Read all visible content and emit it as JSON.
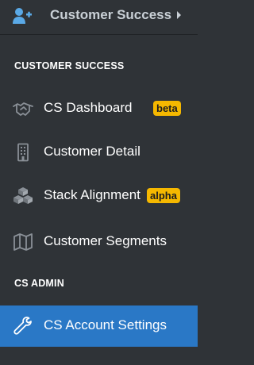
{
  "header": {
    "title": "Customer Success",
    "lead_icon": "user-plus-icon",
    "caret_icon": "caret-right-icon"
  },
  "sections": [
    {
      "label": "CUSTOMER SUCCESS",
      "items": [
        {
          "label": "CS Dashboard",
          "icon": "handshake-icon",
          "badge": "beta"
        },
        {
          "label": "Customer Detail",
          "icon": "building-icon"
        },
        {
          "label": "Stack Alignment",
          "icon": "cubes-icon",
          "badge": "alpha"
        },
        {
          "label": "Customer Segments",
          "icon": "map-icon"
        }
      ]
    },
    {
      "label": "CS ADMIN",
      "items": [
        {
          "label": "CS Account Settings",
          "icon": "wrench-icon",
          "active": true
        }
      ]
    }
  ],
  "colors": {
    "background": "#2f3337",
    "active": "#2a78c6",
    "badge": "#f5b800",
    "icon_header": "#5aa9e6",
    "icon_muted": "#8a9097"
  }
}
